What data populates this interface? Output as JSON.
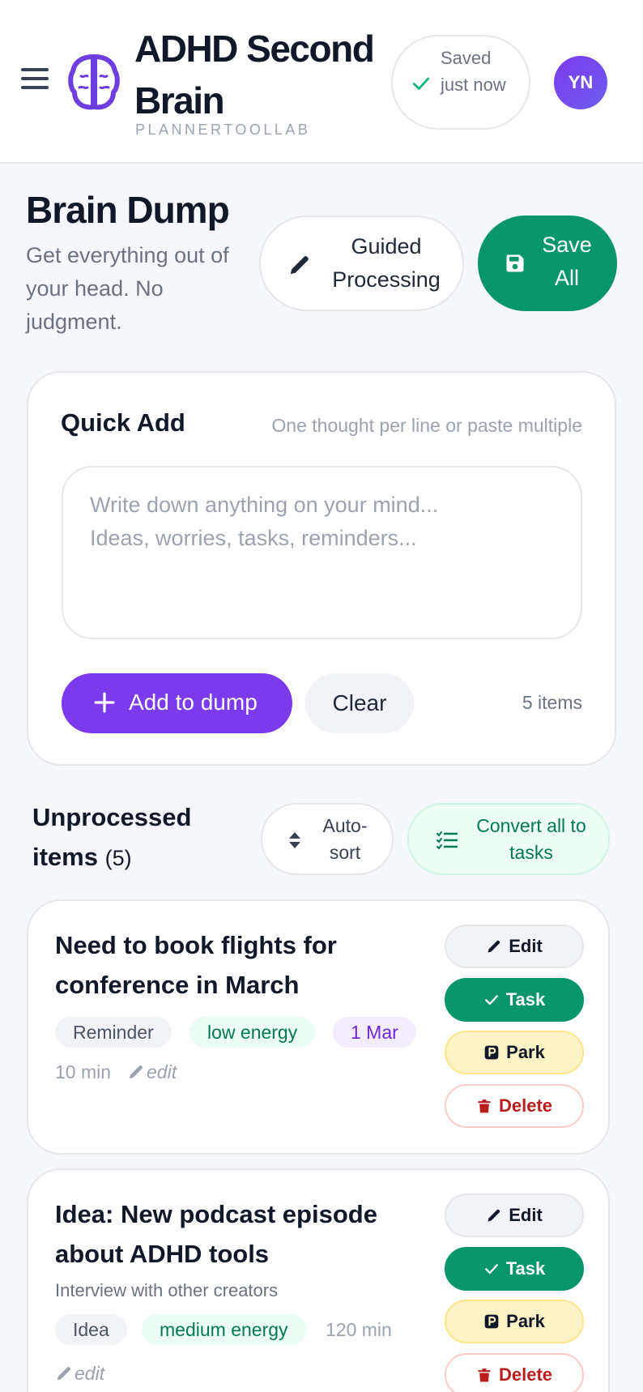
{
  "header": {
    "title": "ADHD Second Brain",
    "subtitle": "PLANNERTOOLLAB",
    "save_status": "Saved just now",
    "avatar_initials": "YN",
    "icons": {
      "menu": "hamburger-icon",
      "logo": "brain-logo-icon",
      "status": "check-icon"
    }
  },
  "page": {
    "title": "Brain Dump",
    "description": "Get everything out of your head. No judgment.",
    "guided_label": "Guided Processing",
    "save_all_label": "Save All"
  },
  "quick_add": {
    "title": "Quick Add",
    "hint": "One thought per line or paste multiple",
    "placeholder": "Write down anything on your mind...\nIdeas, worries, tasks, reminders...",
    "value": "",
    "add_label": "Add to dump",
    "clear_label": "Clear",
    "count": "5 items"
  },
  "unprocessed": {
    "title": "Unprocessed items",
    "count": "(5)",
    "autosort_label": "Auto-sort",
    "convert_label": "Convert all to tasks"
  },
  "items": [
    {
      "title": "Need to book flights for conference in March",
      "note": "",
      "category": "Reminder",
      "energy": "low energy",
      "date": "1 Mar",
      "duration": "10 min",
      "edit": "edit"
    },
    {
      "title": "Idea: New podcast episode about ADHD tools",
      "note": "Interview with other creators",
      "category": "Idea",
      "energy": "medium energy",
      "date": "",
      "duration": "120 min",
      "edit": "edit"
    }
  ],
  "actions": {
    "edit": "Edit",
    "task": "Task",
    "park": "Park",
    "delete": "Delete"
  },
  "colors": {
    "primary_purple": "#7c3aed",
    "success_green": "#069669",
    "danger_red": "#b91c1c",
    "park_yellow": "#fef3c7"
  }
}
